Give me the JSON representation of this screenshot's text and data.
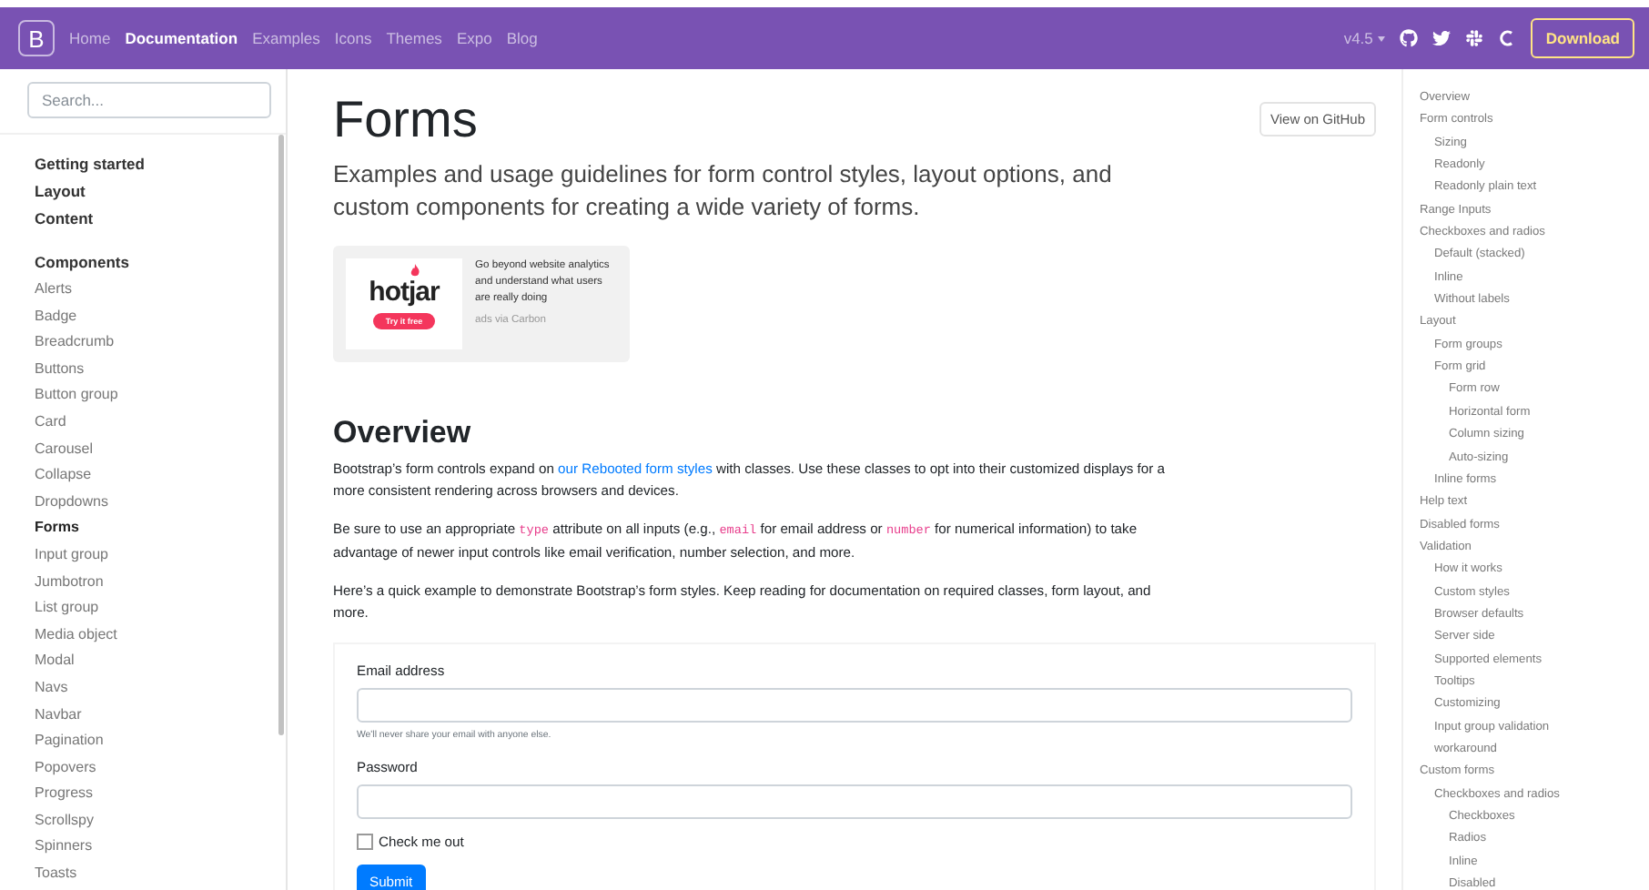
{
  "navbar": {
    "brand": "B",
    "links": [
      {
        "label": "Home",
        "selected": false
      },
      {
        "label": "Documentation",
        "selected": true
      },
      {
        "label": "Examples",
        "selected": false
      },
      {
        "label": "Icons",
        "selected": false
      },
      {
        "label": "Themes",
        "selected": false
      },
      {
        "label": "Expo",
        "selected": false
      },
      {
        "label": "Blog",
        "selected": false
      }
    ],
    "version": "v4.5",
    "download": "Download"
  },
  "sidebar": {
    "search_placeholder": "Search...",
    "sections": [
      {
        "title": "Getting started"
      },
      {
        "title": "Layout"
      },
      {
        "title": "Content"
      },
      {
        "title": "Components",
        "items": [
          {
            "label": "Alerts",
            "selected": false
          },
          {
            "label": "Badge",
            "selected": false
          },
          {
            "label": "Breadcrumb",
            "selected": false
          },
          {
            "label": "Buttons",
            "selected": false
          },
          {
            "label": "Button group",
            "selected": false
          },
          {
            "label": "Card",
            "selected": false
          },
          {
            "label": "Carousel",
            "selected": false
          },
          {
            "label": "Collapse",
            "selected": false
          },
          {
            "label": "Dropdowns",
            "selected": false
          },
          {
            "label": "Forms",
            "selected": true
          },
          {
            "label": "Input group",
            "selected": false
          },
          {
            "label": "Jumbotron",
            "selected": false
          },
          {
            "label": "List group",
            "selected": false
          },
          {
            "label": "Media object",
            "selected": false
          },
          {
            "label": "Modal",
            "selected": false
          },
          {
            "label": "Navs",
            "selected": false
          },
          {
            "label": "Navbar",
            "selected": false
          },
          {
            "label": "Pagination",
            "selected": false
          },
          {
            "label": "Popovers",
            "selected": false
          },
          {
            "label": "Progress",
            "selected": false
          },
          {
            "label": "Scrollspy",
            "selected": false
          },
          {
            "label": "Spinners",
            "selected": false
          },
          {
            "label": "Toasts",
            "selected": false
          }
        ]
      }
    ]
  },
  "main": {
    "title": "Forms",
    "github": "View on GitHub",
    "lead": "Examples and usage guidelines for form control styles, layout options, and custom components for creating a wide variety of forms.",
    "ad": {
      "logo": "hotjar",
      "cta": "Try it free",
      "text": "Go beyond website analytics and understand what users are really doing",
      "via": "ads via Carbon"
    },
    "heading": "Overview",
    "paragraphs": [
      [
        {
          "kind": "text",
          "text": "Bootstrap’s form controls expand on "
        },
        {
          "kind": "link",
          "text": "our Rebooted form styles"
        },
        {
          "kind": "text",
          "text": " with classes. Use these classes to opt into their customized displays for a more consistent rendering across browsers and devices."
        }
      ],
      [
        {
          "kind": "text",
          "text": "Be sure to use an appropriate "
        },
        {
          "kind": "code",
          "text": "type"
        },
        {
          "kind": "text",
          "text": " attribute on all inputs (e.g., "
        },
        {
          "kind": "code",
          "text": "email"
        },
        {
          "kind": "text",
          "text": " for email address or "
        },
        {
          "kind": "code",
          "text": "number"
        },
        {
          "kind": "text",
          "text": " for numerical information) to take advantage of newer input controls like email verification, number selection, and more."
        }
      ],
      [
        {
          "kind": "text",
          "text": "Here’s a quick example to demonstrate Bootstrap’s form styles. Keep reading for documentation on required classes, form layout, and more."
        }
      ]
    ],
    "form": {
      "email_label": "Email address",
      "email_help": "We'll never share your email with anyone else.",
      "password_label": "Password",
      "checkbox": {
        "label": "Check me out",
        "checked": false
      },
      "submit": "Submit"
    }
  },
  "toc": [
    {
      "label": "Overview"
    },
    {
      "label": "Form controls",
      "children": [
        {
          "label": "Sizing"
        },
        {
          "label": "Readonly"
        },
        {
          "label": "Readonly plain text"
        }
      ]
    },
    {
      "label": "Range Inputs"
    },
    {
      "label": "Checkboxes and radios",
      "children": [
        {
          "label": "Default (stacked)"
        },
        {
          "label": "Inline"
        },
        {
          "label": "Without labels"
        }
      ]
    },
    {
      "label": "Layout",
      "children": [
        {
          "label": "Form groups"
        },
        {
          "label": "Form grid",
          "children": [
            {
              "label": "Form row"
            },
            {
              "label": "Horizontal form"
            },
            {
              "label": "Column sizing"
            },
            {
              "label": "Auto-sizing"
            }
          ]
        },
        {
          "label": "Inline forms"
        }
      ]
    },
    {
      "label": "Help text"
    },
    {
      "label": "Disabled forms"
    },
    {
      "label": "Validation",
      "children": [
        {
          "label": "How it works"
        },
        {
          "label": "Custom styles"
        },
        {
          "label": "Browser defaults"
        },
        {
          "label": "Server side"
        },
        {
          "label": "Supported elements"
        },
        {
          "label": "Tooltips"
        },
        {
          "label": "Customizing"
        },
        {
          "label": "Input group validation workaround"
        }
      ]
    },
    {
      "label": "Custom forms",
      "children": [
        {
          "label": "Checkboxes and radios",
          "children": [
            {
              "label": "Checkboxes"
            },
            {
              "label": "Radios"
            },
            {
              "label": "Inline"
            },
            {
              "label": "Disabled"
            }
          ]
        }
      ]
    }
  ]
}
